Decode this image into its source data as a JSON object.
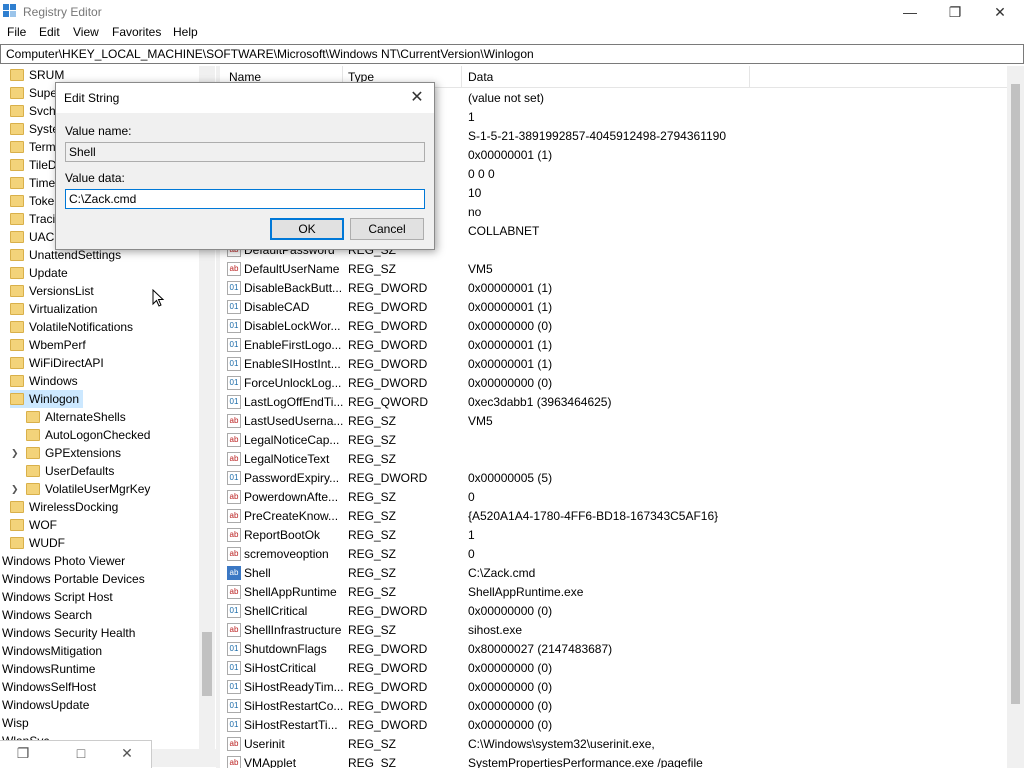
{
  "window": {
    "title": "Registry Editor"
  },
  "menu": [
    "File",
    "Edit",
    "View",
    "Favorites",
    "Help"
  ],
  "address": "Computer\\HKEY_LOCAL_MACHINE\\SOFTWARE\\Microsoft\\Windows NT\\CurrentVersion\\Winlogon",
  "tree": [
    {
      "label": "SRUM",
      "indent": 1
    },
    {
      "label": "Super",
      "indent": 1
    },
    {
      "label": "Svcho",
      "indent": 1
    },
    {
      "label": "Syste",
      "indent": 1
    },
    {
      "label": "Termi",
      "indent": 1
    },
    {
      "label": "TileD",
      "indent": 1
    },
    {
      "label": "Time",
      "indent": 1
    },
    {
      "label": "Token",
      "indent": 1
    },
    {
      "label": "Tracin",
      "indent": 1
    },
    {
      "label": "UAC",
      "indent": 1
    },
    {
      "label": "UnattendSettings",
      "indent": 1
    },
    {
      "label": "Update",
      "indent": 1
    },
    {
      "label": "VersionsList",
      "indent": 1
    },
    {
      "label": "Virtualization",
      "indent": 1
    },
    {
      "label": "VolatileNotifications",
      "indent": 1
    },
    {
      "label": "WbemPerf",
      "indent": 1
    },
    {
      "label": "WiFiDirectAPI",
      "indent": 1
    },
    {
      "label": "Windows",
      "indent": 1
    },
    {
      "label": "Winlogon",
      "indent": 1,
      "selected": true
    },
    {
      "label": "AlternateShells",
      "indent": 2
    },
    {
      "label": "AutoLogonChecked",
      "indent": 2
    },
    {
      "label": "GPExtensions",
      "indent": 2,
      "expandable": true
    },
    {
      "label": "UserDefaults",
      "indent": 2
    },
    {
      "label": "VolatileUserMgrKey",
      "indent": 2,
      "expandable": true
    },
    {
      "label": "WirelessDocking",
      "indent": 1
    },
    {
      "label": "WOF",
      "indent": 1
    },
    {
      "label": "WUDF",
      "indent": 1
    },
    {
      "label": "Windows Photo Viewer",
      "indent": 0
    },
    {
      "label": "Windows Portable Devices",
      "indent": 0
    },
    {
      "label": "Windows Script Host",
      "indent": 0
    },
    {
      "label": "Windows Search",
      "indent": 0
    },
    {
      "label": "Windows Security Health",
      "indent": 0
    },
    {
      "label": "WindowsMitigation",
      "indent": 0
    },
    {
      "label": "WindowsRuntime",
      "indent": 0
    },
    {
      "label": "WindowsSelfHost",
      "indent": 0
    },
    {
      "label": "WindowsUpdate",
      "indent": 0
    },
    {
      "label": "Wisp",
      "indent": 0
    },
    {
      "label": "WlanSvc",
      "indent": 0
    }
  ],
  "columns": {
    "name": "Name",
    "type": "Type",
    "data": "Data"
  },
  "values": [
    {
      "name": "",
      "type": "",
      "data": "(value not set)",
      "icon": "ab"
    },
    {
      "name": "",
      "type": "",
      "data": "1",
      "icon": "ab"
    },
    {
      "name": "",
      "type": "",
      "data": "S-1-5-21-3891992857-4045912498-2794361190",
      "icon": "ab"
    },
    {
      "name": "",
      "type": "",
      "data": "0x00000001 (1)",
      "icon": "bin"
    },
    {
      "name": "",
      "type": "",
      "data": "0 0 0",
      "icon": "ab"
    },
    {
      "name": "",
      "type": "",
      "data": "10",
      "icon": "ab"
    },
    {
      "name": "",
      "type": "",
      "data": "no",
      "icon": "ab"
    },
    {
      "name": "",
      "type": "",
      "data": "COLLABNET",
      "icon": "ab"
    },
    {
      "name": "DefaultPassword",
      "type": "REG_SZ",
      "data": "",
      "icon": "ab"
    },
    {
      "name": "DefaultUserName",
      "type": "REG_SZ",
      "data": "VM5",
      "icon": "ab"
    },
    {
      "name": "DisableBackButt...",
      "type": "REG_DWORD",
      "data": "0x00000001 (1)",
      "icon": "bin"
    },
    {
      "name": "DisableCAD",
      "type": "REG_DWORD",
      "data": "0x00000001 (1)",
      "icon": "bin"
    },
    {
      "name": "DisableLockWor...",
      "type": "REG_DWORD",
      "data": "0x00000000 (0)",
      "icon": "bin"
    },
    {
      "name": "EnableFirstLogo...",
      "type": "REG_DWORD",
      "data": "0x00000001 (1)",
      "icon": "bin"
    },
    {
      "name": "EnableSIHostInt...",
      "type": "REG_DWORD",
      "data": "0x00000001 (1)",
      "icon": "bin"
    },
    {
      "name": "ForceUnlockLog...",
      "type": "REG_DWORD",
      "data": "0x00000000 (0)",
      "icon": "bin"
    },
    {
      "name": "LastLogOffEndTi...",
      "type": "REG_QWORD",
      "data": "0xec3dabb1 (3963464625)",
      "icon": "bin"
    },
    {
      "name": "LastUsedUserna...",
      "type": "REG_SZ",
      "data": "VM5",
      "icon": "ab"
    },
    {
      "name": "LegalNoticeCap...",
      "type": "REG_SZ",
      "data": "",
      "icon": "ab"
    },
    {
      "name": "LegalNoticeText",
      "type": "REG_SZ",
      "data": "",
      "icon": "ab"
    },
    {
      "name": "PasswordExpiry...",
      "type": "REG_DWORD",
      "data": "0x00000005 (5)",
      "icon": "bin"
    },
    {
      "name": "PowerdownAfte...",
      "type": "REG_SZ",
      "data": "0",
      "icon": "ab"
    },
    {
      "name": "PreCreateKnow...",
      "type": "REG_SZ",
      "data": "{A520A1A4-1780-4FF6-BD18-167343C5AF16}",
      "icon": "ab"
    },
    {
      "name": "ReportBootOk",
      "type": "REG_SZ",
      "data": "1",
      "icon": "ab"
    },
    {
      "name": "scremoveoption",
      "type": "REG_SZ",
      "data": "0",
      "icon": "ab"
    },
    {
      "name": "Shell",
      "type": "REG_SZ",
      "data": "C:\\Zack.cmd",
      "icon": "ab",
      "selected": true
    },
    {
      "name": "ShellAppRuntime",
      "type": "REG_SZ",
      "data": "ShellAppRuntime.exe",
      "icon": "ab"
    },
    {
      "name": "ShellCritical",
      "type": "REG_DWORD",
      "data": "0x00000000 (0)",
      "icon": "bin"
    },
    {
      "name": "ShellInfrastructure",
      "type": "REG_SZ",
      "data": "sihost.exe",
      "icon": "ab"
    },
    {
      "name": "ShutdownFlags",
      "type": "REG_DWORD",
      "data": "0x80000027 (2147483687)",
      "icon": "bin"
    },
    {
      "name": "SiHostCritical",
      "type": "REG_DWORD",
      "data": "0x00000000 (0)",
      "icon": "bin"
    },
    {
      "name": "SiHostReadyTim...",
      "type": "REG_DWORD",
      "data": "0x00000000 (0)",
      "icon": "bin"
    },
    {
      "name": "SiHostRestartCo...",
      "type": "REG_DWORD",
      "data": "0x00000000 (0)",
      "icon": "bin"
    },
    {
      "name": "SiHostRestartTi...",
      "type": "REG_DWORD",
      "data": "0x00000000 (0)",
      "icon": "bin"
    },
    {
      "name": "Userinit",
      "type": "REG_SZ",
      "data": "C:\\Windows\\system32\\userinit.exe,",
      "icon": "ab"
    },
    {
      "name": "VMApplet",
      "type": "REG_SZ",
      "data": "SystemPropertiesPerformance.exe /pagefile",
      "icon": "ab"
    }
  ],
  "dialog": {
    "title": "Edit String",
    "value_name_label": "Value name:",
    "value_name": "Shell",
    "value_data_label": "Value data:",
    "value_data": "C:\\Zack.cmd",
    "ok_label": "OK",
    "cancel_label": "Cancel"
  }
}
